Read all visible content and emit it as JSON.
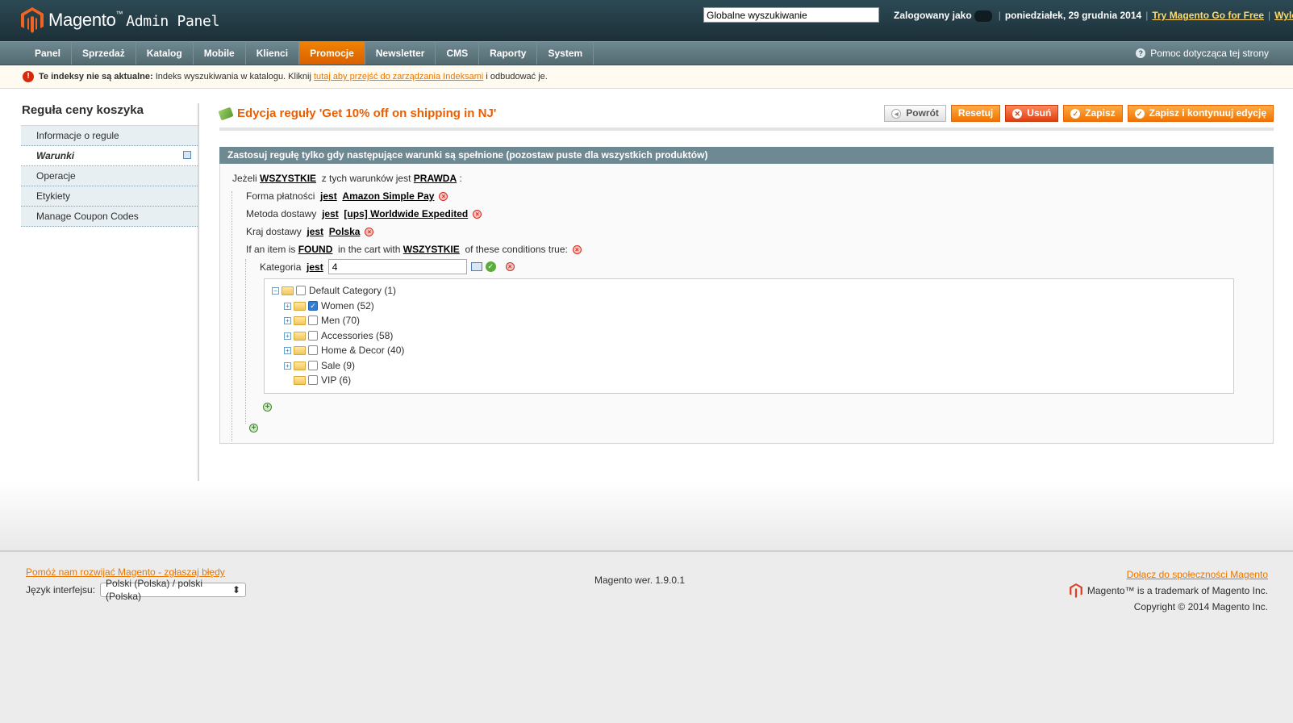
{
  "header": {
    "logo_title": "Magento",
    "logo_tm": "™",
    "logo_sub": "Admin Panel",
    "search_value": "Globalne wyszukiwanie",
    "logged_in_label": "Zalogowany jako",
    "date": "poniedziałek, 29 grudnia 2014",
    "try_link": "Try Magento Go for Free",
    "logout": "Wyloguj"
  },
  "nav": {
    "items": [
      "Panel",
      "Sprzedaż",
      "Katalog",
      "Mobile",
      "Klienci",
      "Promocje",
      "Newsletter",
      "CMS",
      "Raporty",
      "System"
    ],
    "active": "Promocje",
    "help": "Pomoc dotycząca tej strony"
  },
  "notice": {
    "bold": "Te indeksy nie są aktualne:",
    "text": "Indeks wyszukiwania w katalogu. Kliknij",
    "link": "tutaj aby przejść do zarządzania Indeksami",
    "after": "i odbudować je."
  },
  "sidebar": {
    "title": "Reguła ceny koszyka",
    "tabs": [
      "Informacje o regule",
      "Warunki",
      "Operacje",
      "Etykiety",
      "Manage Coupon Codes"
    ],
    "active_tab": "Warunki"
  },
  "page": {
    "title": "Edycja reguły 'Get 10% off on shipping in NJ'",
    "buttons": {
      "back": "Powrót",
      "reset": "Resetuj",
      "delete": "Usuń",
      "save": "Zapisz",
      "save_continue": "Zapisz i kontynuuj edycję"
    }
  },
  "conditions": {
    "header": "Zastosuj regułę tylko gdy następujące warunki są spełnione (pozostaw puste dla wszystkich produktów)",
    "root": {
      "if": "Jeżeli",
      "aggregator": "WSZYSTKIE",
      "middle": "z tych warunków jest",
      "value": "PRAWDA",
      "end": ":"
    },
    "rows": [
      {
        "attr": "Forma płatności",
        "op": "jest",
        "value": "Amazon Simple Pay"
      },
      {
        "attr": "Metoda dostawy",
        "op": "jest",
        "value": "[ups] Worldwide Expedited"
      },
      {
        "attr": "Kraj dostawy",
        "op": "jest",
        "value": "Polska"
      }
    ],
    "found": {
      "pre": "If an item is",
      "found": "FOUND",
      "mid": "in the cart with",
      "agg": "WSZYSTKIE",
      "post": "of these conditions true:"
    },
    "category": {
      "attr": "Kategoria",
      "op": "jest",
      "value": "4"
    },
    "tree": [
      {
        "label": "Default Category (1)",
        "checked": false
      },
      {
        "label": "Women (52)",
        "checked": true
      },
      {
        "label": "Men (70)",
        "checked": false
      },
      {
        "label": "Accessories (58)",
        "checked": false
      },
      {
        "label": "Home & Decor (40)",
        "checked": false
      },
      {
        "label": "Sale (9)",
        "checked": false
      },
      {
        "label": "VIP (6)",
        "checked": false
      }
    ]
  },
  "footer": {
    "bug_link": "Pomóż nam rozwijać Magento - zgłaszaj błędy",
    "lang_label": "Język interfejsu:",
    "lang_value": "Polski (Polska) / polski (Polska)",
    "version": "Magento wer. 1.9.0.1",
    "community_link": "Dołącz do społeczności Magento",
    "trademark": "Magento™ is a trademark of Magento Inc.",
    "copyright": "Copyright © 2014 Magento Inc."
  },
  "colors": {
    "accent": "#eb5e00",
    "nav": "#6f8992",
    "header": "#1c2f37"
  }
}
